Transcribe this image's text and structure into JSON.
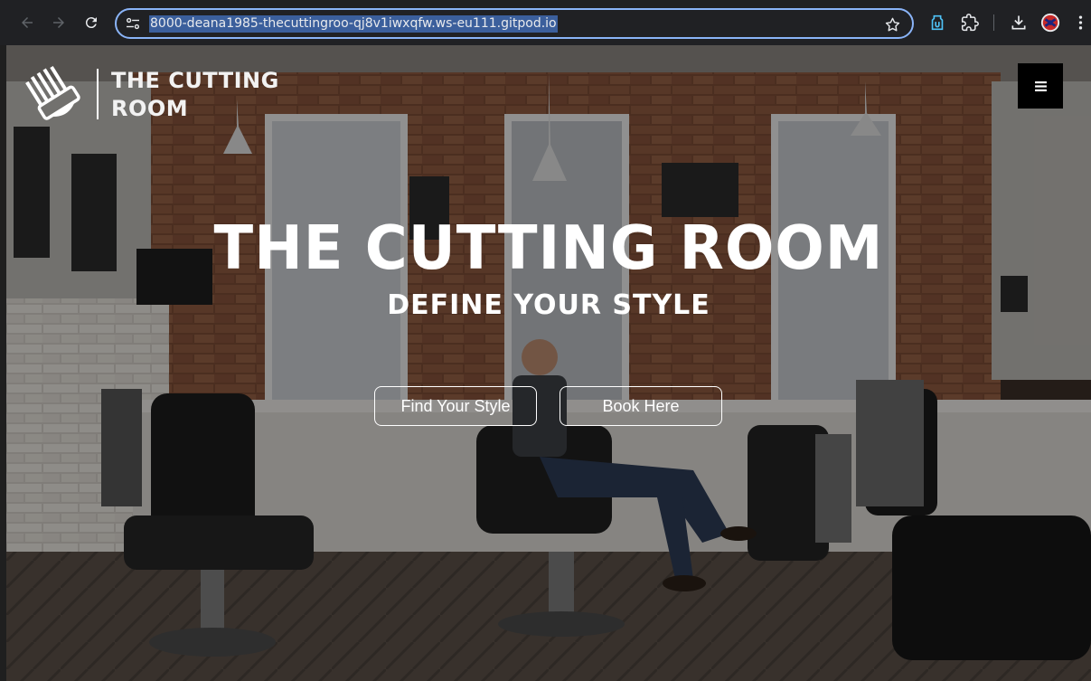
{
  "browser": {
    "url": "8000-deana1985-thecuttingroo-qj8v1iwxqfw.ws-eu111.gitpod.io",
    "icons": [
      "back-arrow-icon",
      "forward-arrow-icon",
      "reload-icon",
      "site-info-icon",
      "bookmark-star-icon",
      "extension-icon",
      "puzzle-extensions-icon",
      "download-icon",
      "profile-avatar-icon",
      "more-menu-icon"
    ],
    "colors": {
      "chrome": "#202124",
      "omnibox_border": "#8ab4f8",
      "url_highlight": "#3b5f9c"
    }
  },
  "site": {
    "logo": {
      "line1": "THE CUTTING",
      "line2": "ROOM",
      "icon": "comb-icon"
    },
    "menu_icon": "hamburger-menu-icon",
    "hero": {
      "title": "THE CUTTING ROOM",
      "subtitle": "DEFINE YOUR STYLE",
      "buttons": {
        "find": "Find Your Style",
        "book": "Book Here"
      }
    },
    "colors": {
      "text": "#ffffff",
      "menu_button": "#000000"
    }
  }
}
